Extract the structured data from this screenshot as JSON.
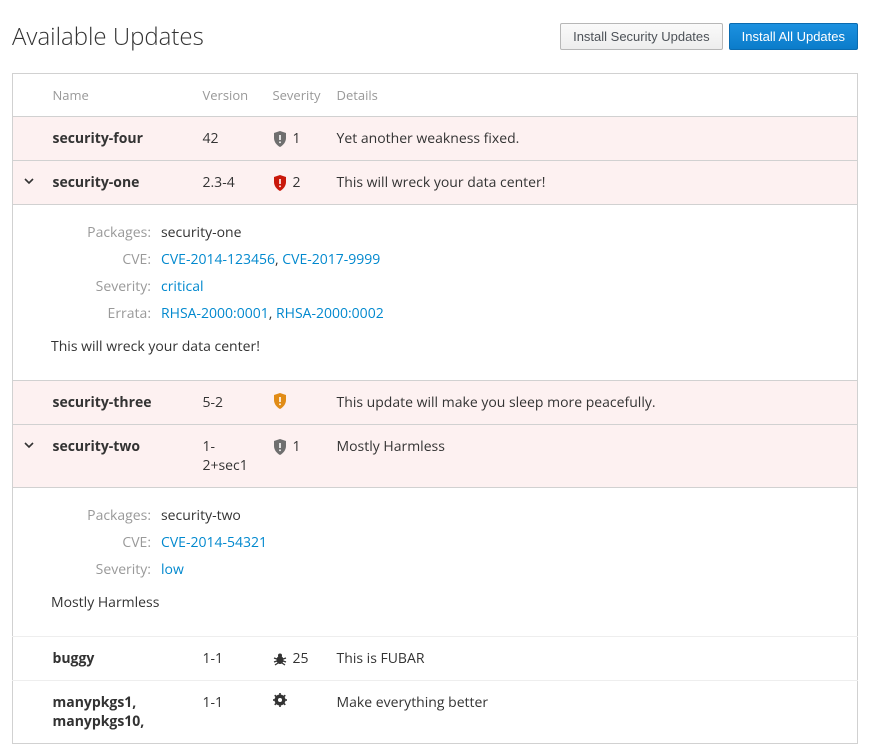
{
  "header": {
    "title": "Available Updates",
    "install_security_label": "Install Security Updates",
    "install_all_label": "Install All Updates"
  },
  "columns": {
    "name": "Name",
    "version": "Version",
    "severity": "Severity",
    "details": "Details"
  },
  "detailLabels": {
    "packages": "Packages:",
    "cve": "CVE:",
    "severity": "Severity:",
    "errata": "Errata:"
  },
  "rows": [
    {
      "name": "security-four",
      "version": "42",
      "sev_icon": "shield-grey",
      "sev_count": "1",
      "details": "Yet another weakness fixed."
    },
    {
      "name": "security-one",
      "version": "2.3-4",
      "sev_icon": "shield-red",
      "sev_count": "2",
      "details": "This will wreck your data center!"
    },
    {
      "name": "security-three",
      "version": "5-2",
      "sev_icon": "shield-orange",
      "sev_count": "",
      "details": "This update will make you sleep more peacefully."
    },
    {
      "name": "security-two",
      "version": "1-2+sec1",
      "sev_icon": "shield-grey",
      "sev_count": "1",
      "details": "Mostly Harmless"
    },
    {
      "name": "buggy",
      "version": "1-1",
      "sev_icon": "bug",
      "sev_count": "25",
      "details": "This is FUBAR"
    },
    {
      "name": "manypkgs1, manypkgs10,",
      "version": "1-1",
      "sev_icon": "gear",
      "sev_count": "",
      "details": "Make everything better"
    }
  ],
  "expanded": {
    "one": {
      "packages": "security-one",
      "cve": [
        "CVE-2014-123456",
        "CVE-2017-9999"
      ],
      "severity": "critical",
      "errata": [
        "RHSA-2000:0001",
        "RHSA-2000:0002"
      ],
      "desc": "This will wreck your data center!"
    },
    "two": {
      "packages": "security-two",
      "cve": [
        "CVE-2014-54321"
      ],
      "severity": "low",
      "desc": "Mostly Harmless"
    }
  },
  "colors": {
    "shield_grey": "#6f6f6f",
    "shield_red": "#c9190b",
    "shield_orange": "#e18c17",
    "link": "#0088ce"
  }
}
